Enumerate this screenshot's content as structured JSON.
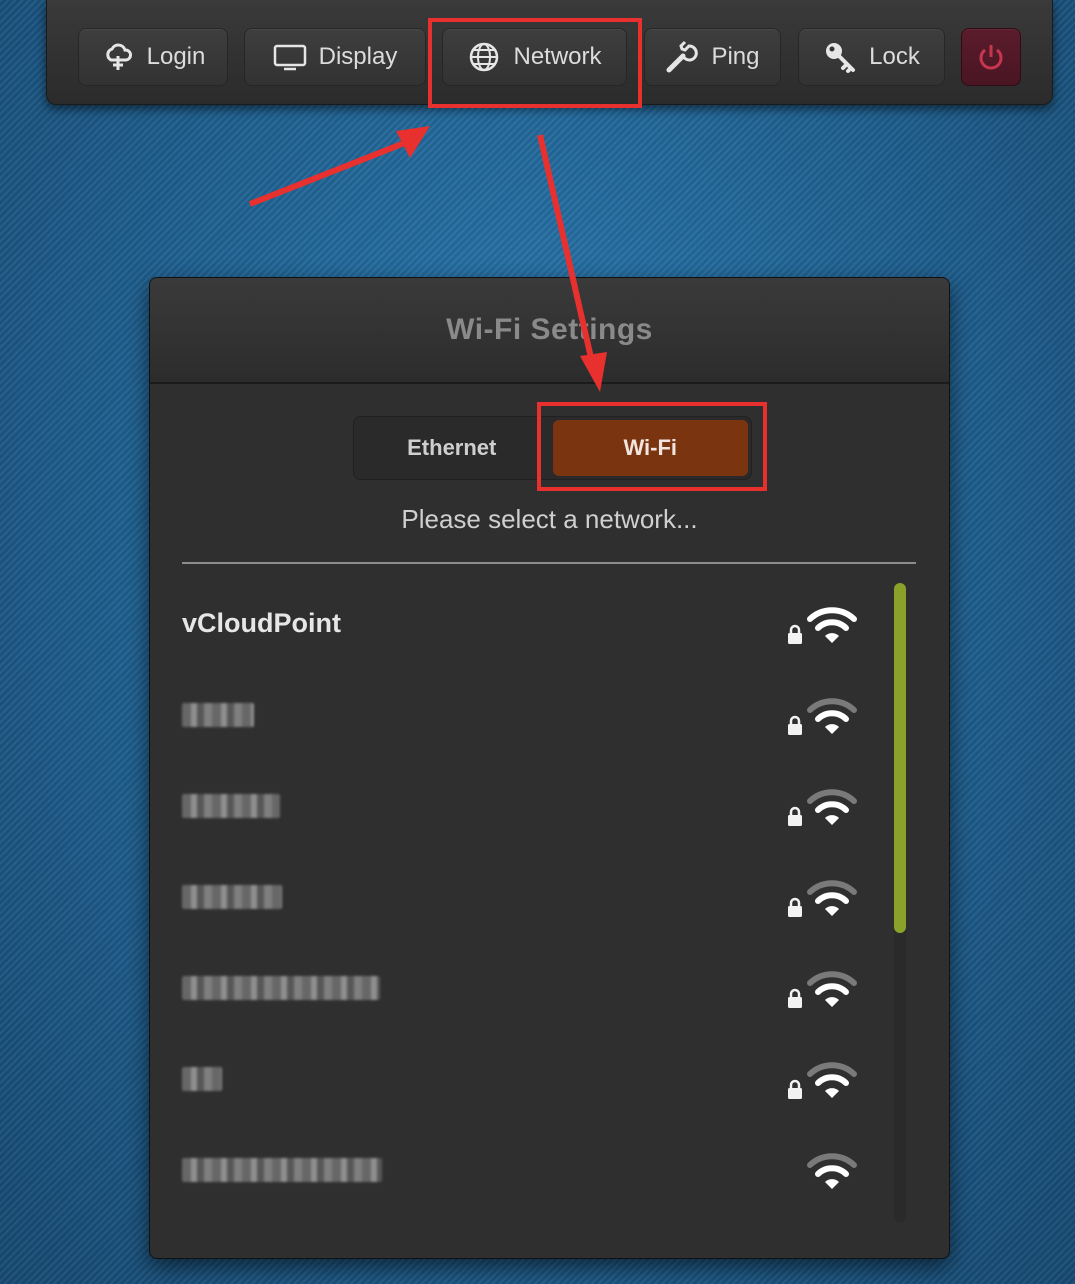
{
  "toolbar": {
    "buttons": [
      {
        "label": "Login",
        "icon": "cloud-icon"
      },
      {
        "label": "Display",
        "icon": "monitor-icon"
      },
      {
        "label": "Network",
        "icon": "globe-icon"
      },
      {
        "label": "Ping",
        "icon": "wrench-icon"
      },
      {
        "label": "Lock",
        "icon": "key-icon"
      },
      {
        "label": "",
        "icon": "power-icon"
      }
    ]
  },
  "dialog": {
    "title": "Wi-Fi Settings",
    "tabs": [
      {
        "label": "Ethernet",
        "active": false
      },
      {
        "label": "Wi-Fi",
        "active": true
      }
    ],
    "prompt": "Please select a network...",
    "networks": [
      {
        "ssid": "vCloudPoint",
        "secured": true
      },
      {
        "ssid": "",
        "secured": true,
        "blurred": true
      },
      {
        "ssid": "",
        "secured": true,
        "blurred": true
      },
      {
        "ssid": "",
        "secured": true,
        "blurred": true
      },
      {
        "ssid": "",
        "secured": true,
        "blurred": true
      },
      {
        "ssid": "",
        "secured": true,
        "blurred": true
      },
      {
        "ssid": "",
        "secured": false,
        "blurred": true
      }
    ]
  },
  "colors": {
    "accent_active_tab": "#7a3410",
    "annotation_red": "#e8302f",
    "scroll_thumb": "#8aa12a",
    "power_button": "#5a1c2c"
  }
}
